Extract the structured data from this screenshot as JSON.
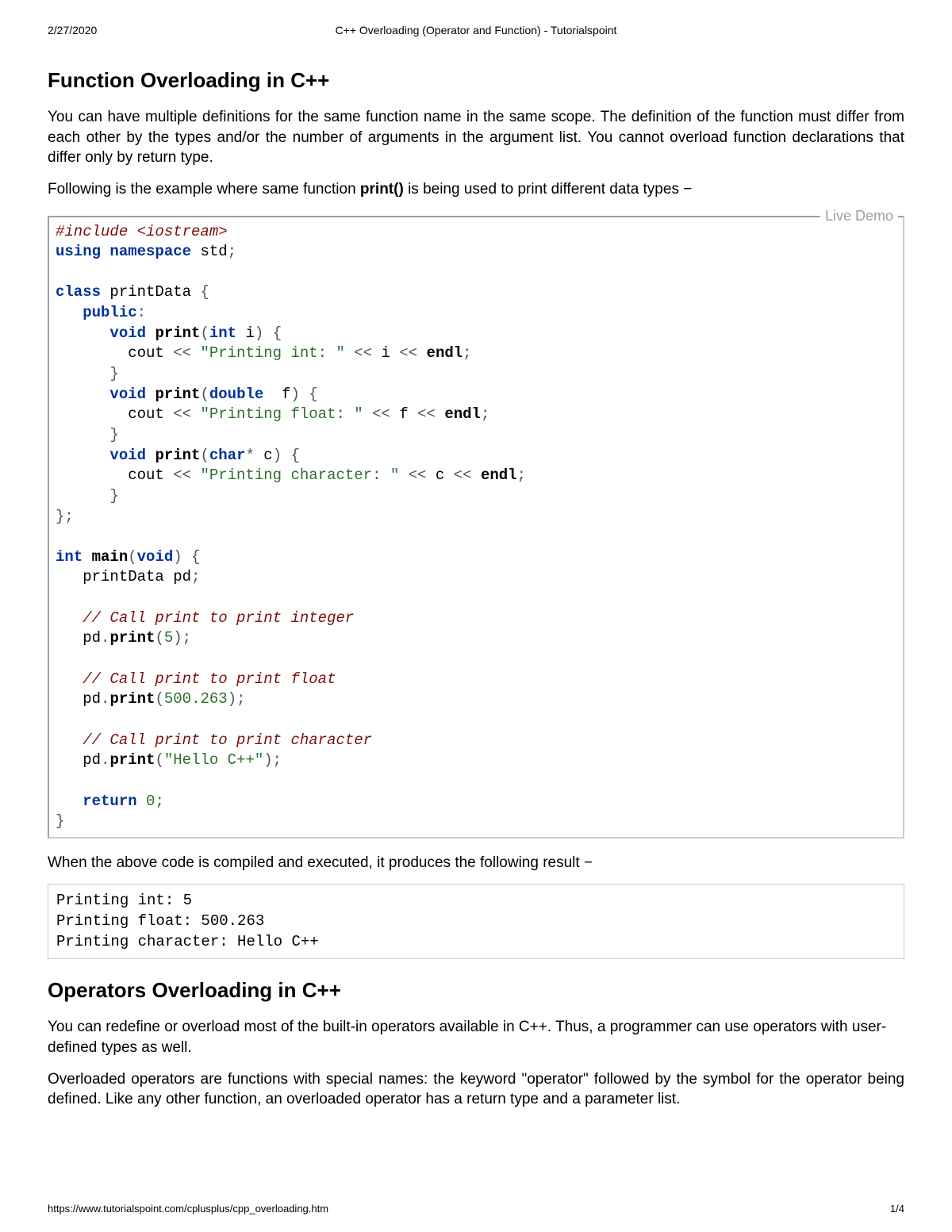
{
  "header": {
    "date": "2/27/2020",
    "title": "C++ Overloading (Operator and Function) - Tutorialspoint"
  },
  "section1": {
    "heading": "Function Overloading in C++",
    "para1": "You can have multiple definitions for the same function name in the same scope. The definition of the function must differ from each other by the types and/or the number of arguments in the argument list. You cannot overload function declarations that differ only by return type.",
    "para2_a": "Following is the example where same function ",
    "para2_bold": "print()",
    "para2_b": " is being used to print different data types −",
    "live_demo": "Live Demo",
    "result_intro": "When the above code is compiled and executed, it produces the following result −",
    "output": "Printing int: 5\nPrinting float: 500.263\nPrinting character: Hello C++"
  },
  "code1": {
    "l1_pp": "#include",
    "l1_hdr": " <iostream>",
    "l2_kw1": "using",
    "l2_kw2": "namespace",
    "l2_id": "std",
    "l4_kw": "class",
    "l4_id": "printData",
    "l5_kw": "public",
    "l6_kw1": "void",
    "l6_fn": "print",
    "l6_kw2": "int",
    "l6_p": "i",
    "l7_id": "cout",
    "l7_str": "\"Printing int: \"",
    "l7_p": "i",
    "l7_endl": "endl",
    "l9_kw1": "void",
    "l9_fn": "print",
    "l9_kw2": "double",
    "l9_p": "f",
    "l10_id": "cout",
    "l10_str": "\"Printing float: \"",
    "l10_p": "f",
    "l10_endl": "endl",
    "l12_kw1": "void",
    "l12_fn": "print",
    "l12_kw2": "char",
    "l12_p": "c",
    "l13_id": "cout",
    "l13_str": "\"Printing character: \"",
    "l13_p": "c",
    "l13_endl": "endl",
    "l17_kw1": "int",
    "l17_fn": "main",
    "l17_kw2": "void",
    "l18_id": "printData pd",
    "l20_cm": "// Call print to print integer",
    "l21_obj": "pd",
    "l21_fn": "print",
    "l21_arg": "5",
    "l23_cm": "// Call print to print float",
    "l24_obj": "pd",
    "l24_fn": "print",
    "l24_arg": "500.263",
    "l26_cm": "// Call print to print character",
    "l27_obj": "pd",
    "l27_fn": "print",
    "l27_arg": "\"Hello C++\"",
    "l29_kw": "return",
    "l29_num": "0"
  },
  "section2": {
    "heading": "Operators Overloading in C++",
    "para1": "You can redefine or overload most of the built-in operators available in C++. Thus, a programmer can use operators with user-defined types as well.",
    "para2": "Overloaded operators are functions with special names: the keyword \"operator\" followed by the symbol for the operator being defined. Like any other function, an overloaded operator has a return type and a parameter list."
  },
  "footer": {
    "url": "https://www.tutorialspoint.com/cplusplus/cpp_overloading.htm",
    "page": "1/4"
  }
}
